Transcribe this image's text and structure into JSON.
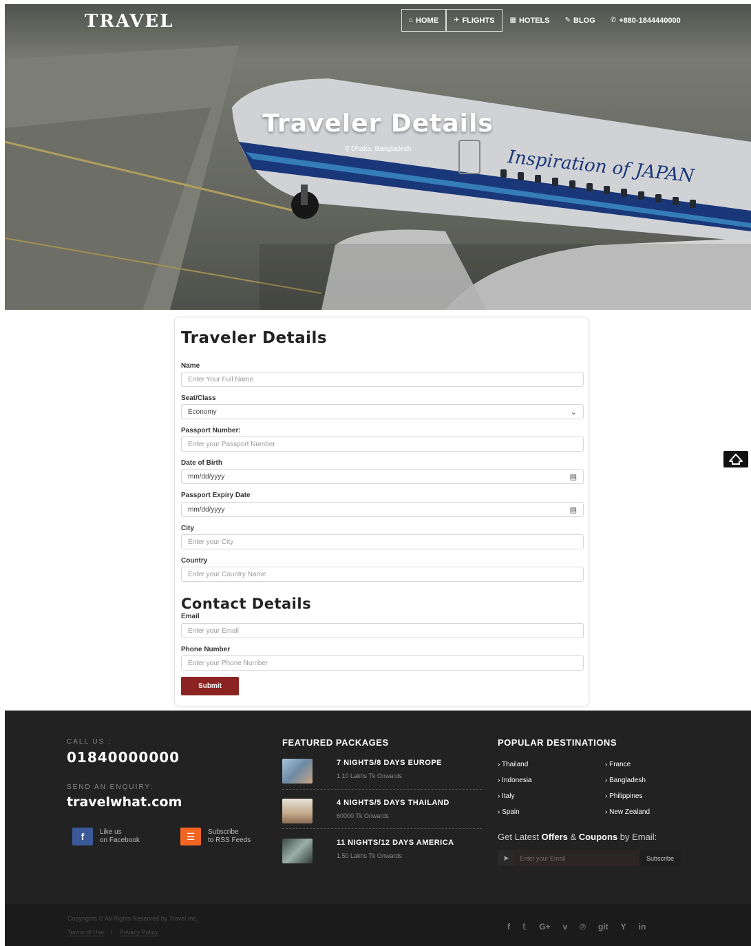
{
  "header": {
    "logo": "TRAVEL",
    "nav": [
      {
        "icon": "home-icon",
        "glyph": "⌂",
        "label": "HOME"
      },
      {
        "icon": "plane-icon",
        "glyph": "✈",
        "label": "FLIGHTS"
      },
      {
        "icon": "building-icon",
        "glyph": "▦",
        "label": "HOTELS"
      },
      {
        "icon": "pencil-icon",
        "glyph": "✎",
        "label": "BLOG"
      },
      {
        "icon": "phone-icon",
        "glyph": "✆",
        "label": "+880-1844440000"
      }
    ]
  },
  "hero": {
    "title": "Traveler Details",
    "location_icon": "map-pin-icon",
    "location": "Dhaka, Bangladesh"
  },
  "form": {
    "title": "Traveler Details",
    "fields": {
      "name": {
        "label": "Name",
        "placeholder": "Enter Your Full Name"
      },
      "seat": {
        "label": "Seat/Class",
        "value": "Economy"
      },
      "passport": {
        "label": "Passport Number:",
        "placeholder": "Enter your Passport Number"
      },
      "dob": {
        "label": "Date of Birth",
        "placeholder": "mm/dd/yyyy"
      },
      "expiry": {
        "label": "Passport Expiry Date",
        "placeholder": "mm/dd/yyyy"
      },
      "city": {
        "label": "City",
        "placeholder": "Enter your City"
      },
      "country": {
        "label": "Country",
        "placeholder": "Enter your Country Name"
      }
    },
    "contact_title": "Contact Details",
    "contact": {
      "email": {
        "label": "Email",
        "placeholder": "Enter your Email"
      },
      "phone": {
        "label": "Phone Number",
        "placeholder": "Enter your Phone Number"
      }
    },
    "submit_label": "Submit"
  },
  "footer": {
    "call_label": "CALL US :",
    "phone": "01840000000",
    "enquiry_label": "SEND AN ENQUIRY:",
    "site": "travelwhat.com",
    "facebook": {
      "line1": "Like us",
      "line2": "on Facebook"
    },
    "rss": {
      "line1": "Subscribe",
      "line2": "to RSS Feeds"
    },
    "packages_title": "FEATURED PACKAGES",
    "packages": [
      {
        "title": "7 NIGHTS/8 DAYS EUROPE",
        "price": "1.10 Lakhs Tk Onwards"
      },
      {
        "title": "4 NIGHTS/5 DAYS THAILAND",
        "price": "60000 Tk Onwards"
      },
      {
        "title": "11 NIGHTS/12 DAYS AMERICA",
        "price": "1.50 Lakhs Tk Onwards"
      }
    ],
    "destinations_title": "POPULAR DESTINATIONS",
    "destinations": [
      "Thailand",
      "France",
      "Indonesia",
      "Bangladesh",
      "Italy",
      "Philippines",
      "Spain",
      "New Zealand"
    ],
    "offers_pre": "Get Latest ",
    "offers_b1": "Offers",
    "offers_mid": " & ",
    "offers_b2": "Coupons",
    "offers_post": " by Email:",
    "email_placeholder": "Enter your Email",
    "subscribe_label": "Subscribe",
    "copyright": "Copyrights © All Rights Reserved by Travel Inc.",
    "terms": "Terms of Use",
    "sep": "/",
    "privacy": "Privacy Policy",
    "social_icons": [
      "facebook-icon",
      "twitter-icon",
      "google-plus-icon",
      "vimeo-icon",
      "pinterest-icon",
      "github-icon",
      "hacker-news-icon",
      "linkedin-icon"
    ],
    "social_glyphs": [
      "f",
      "𝕥",
      "G+",
      "v",
      "℗",
      "git",
      "Y",
      "in"
    ]
  },
  "colors": {
    "accent": "#8b2322",
    "footer_bg": "#222222",
    "facebook": "#3b5998",
    "rss": "#f26522"
  }
}
